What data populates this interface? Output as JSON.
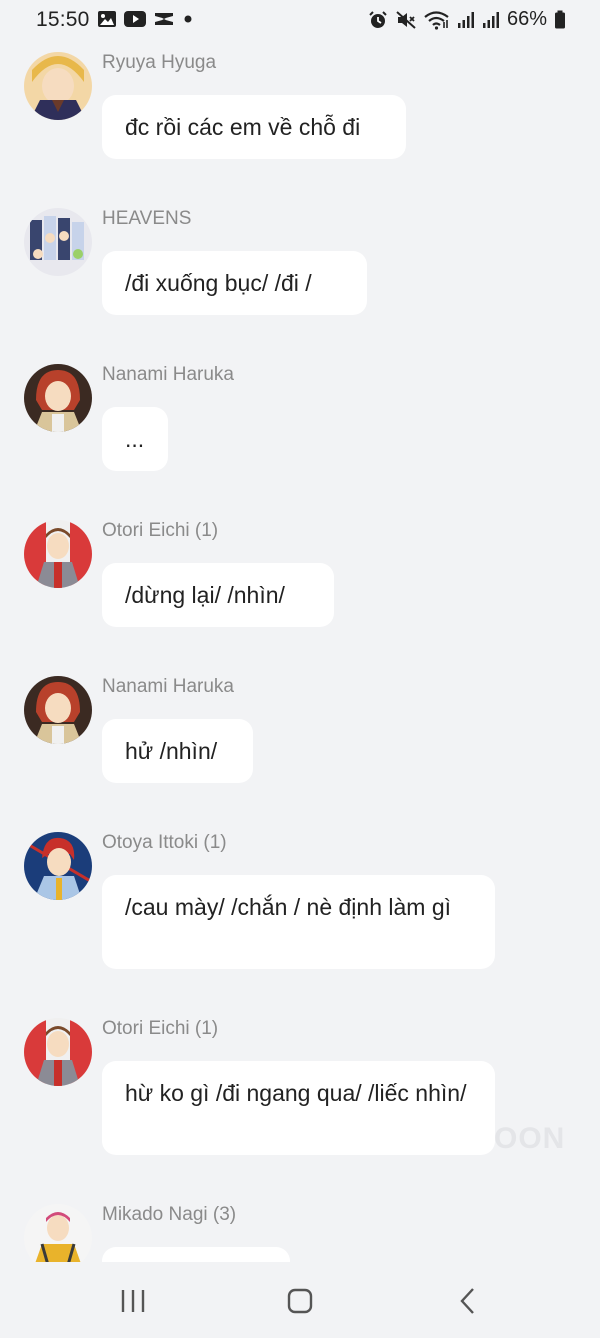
{
  "status_bar": {
    "time": "15:50",
    "battery": "66%",
    "left_icons": [
      "gallery-icon",
      "youtube-icon",
      "capcut-icon",
      "dot-icon"
    ],
    "right_icons": [
      "alarm-icon",
      "mute-icon",
      "wifi-icon",
      "signal-icon",
      "signal-icon",
      "battery-icon"
    ]
  },
  "messages": [
    {
      "sender": "Ryuya Hyuga",
      "text": "đc rồi các em về chỗ đi",
      "avatar_colors": [
        "#e8b84a",
        "#6a3a2a",
        "#2f2f5a"
      ]
    },
    {
      "sender": "HEAVENS",
      "text": "/đi xuống bục/ /đi /",
      "avatar_colors": [
        "#c7d3ea",
        "#39456e",
        "#e8e8ee"
      ]
    },
    {
      "sender": "Nanami Haruka",
      "text": "...",
      "avatar_colors": [
        "#b8412b",
        "#3b2a22",
        "#d9c59a"
      ]
    },
    {
      "sender": "Otori Eichi (1)",
      "text": "/dừng lại/ /nhìn/",
      "avatar_colors": [
        "#d93a3a",
        "#8b8b95",
        "#f0f0f0"
      ]
    },
    {
      "sender": "Nanami Haruka",
      "text": "hử /nhìn/",
      "avatar_colors": [
        "#b8412b",
        "#3b2a22",
        "#d9c59a"
      ]
    },
    {
      "sender": "Otoya Ittoki (1)",
      "text": "/cau mày/ /chắn / nè định làm gì",
      "avatar_colors": [
        "#1b3d7a",
        "#c7302a",
        "#aac6e6"
      ]
    },
    {
      "sender": "Otori Eichi (1)",
      "text": "hừ ko gì /đi ngang qua/ /liếc nhìn/",
      "avatar_colors": [
        "#d93a3a",
        "#8b8b95",
        "#f0f0f0"
      ]
    },
    {
      "sender": "Mikado Nagi (3)",
      "text": "",
      "avatar_colors": [
        "#e9b32b",
        "#d24b7a",
        "#3a3a3a"
      ]
    }
  ],
  "watermark": "OON",
  "nav_bar": {
    "recent_icon": "recent-apps-icon",
    "home_icon": "home-icon",
    "back_icon": "back-icon"
  }
}
